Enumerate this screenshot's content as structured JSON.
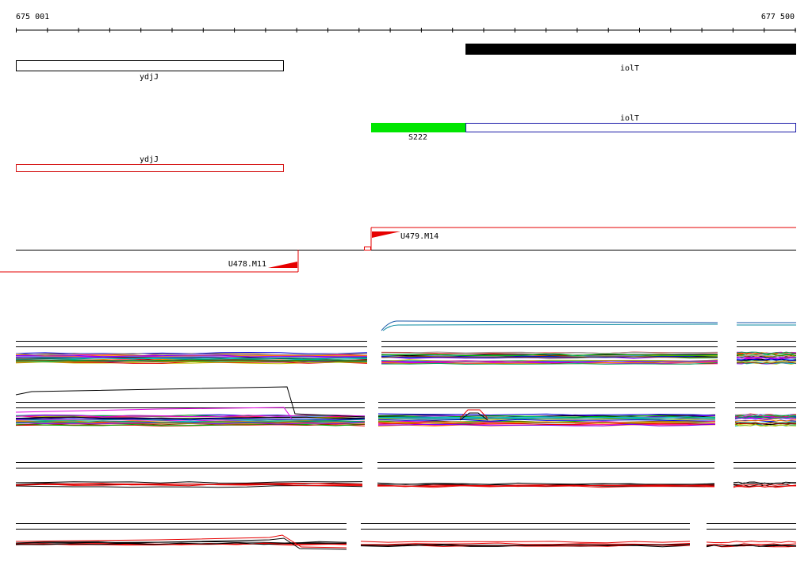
{
  "ruler": {
    "start_label": "675 001",
    "end_label": "677 500"
  },
  "features": {
    "iolT_black": {
      "name": "iolT",
      "color": "#000000"
    },
    "ydjJ_black": {
      "name": "ydjJ",
      "color": "#000000"
    },
    "iolT_blue": {
      "name": "iolT",
      "color": "#1a1aa8"
    },
    "S222_green": {
      "name": "S222",
      "color": "#00e600"
    },
    "ydjJ_red": {
      "name": "ydjJ",
      "color": "#d61a1a"
    }
  },
  "transcription_units": {
    "forward": {
      "name": "U479.M14",
      "color": "#e60000"
    },
    "reverse": {
      "name": "U478.M11",
      "color": "#e60000"
    }
  },
  "palette": [
    "#000000",
    "#e60000",
    "#00b000",
    "#0000e0",
    "#e000e0",
    "#00c0c0",
    "#c0c000",
    "#ff8000",
    "#8000ff",
    "#00a060",
    "#a0a0a0",
    "#804000",
    "#ff0080",
    "#60a0ff"
  ]
}
